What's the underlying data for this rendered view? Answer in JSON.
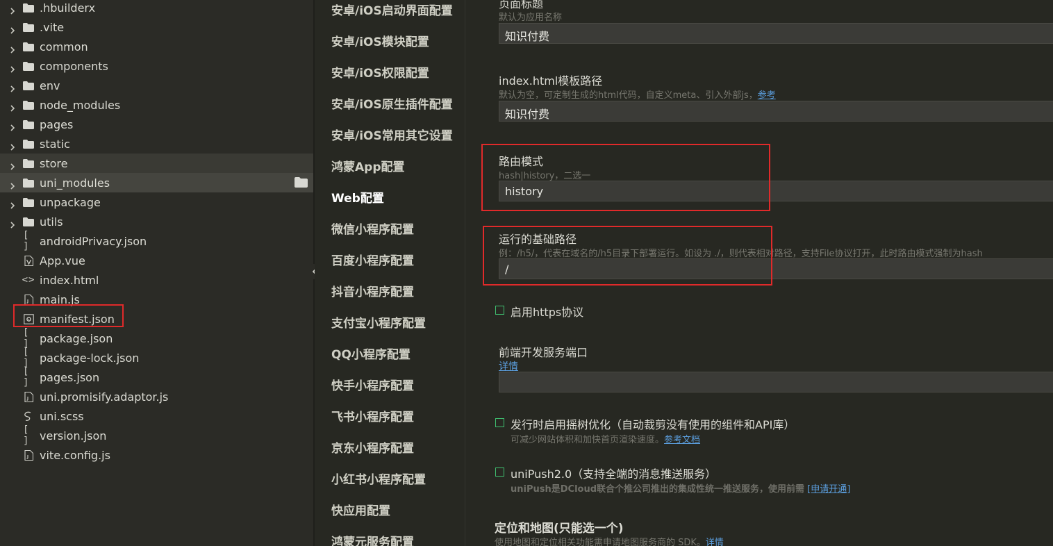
{
  "tree": {
    "items": [
      {
        "name": ".hbuilderx",
        "type": "folder"
      },
      {
        "name": ".vite",
        "type": "folder"
      },
      {
        "name": "common",
        "type": "folder"
      },
      {
        "name": "components",
        "type": "folder"
      },
      {
        "name": "env",
        "type": "folder"
      },
      {
        "name": "node_modules",
        "type": "folder"
      },
      {
        "name": "pages",
        "type": "folder"
      },
      {
        "name": "static",
        "type": "folder"
      },
      {
        "name": "store",
        "type": "folder",
        "state": "selected"
      },
      {
        "name": "uni_modules",
        "type": "folder",
        "state": "hover"
      },
      {
        "name": "unpackage",
        "type": "folder"
      },
      {
        "name": "utils",
        "type": "folder"
      },
      {
        "name": "androidPrivacy.json",
        "type": "json",
        "icon": "[ ]"
      },
      {
        "name": "App.vue",
        "type": "vue"
      },
      {
        "name": "index.html",
        "type": "html",
        "icon": "<>"
      },
      {
        "name": "main.js",
        "type": "js"
      },
      {
        "name": "manifest.json",
        "type": "manifest",
        "highlighted": true
      },
      {
        "name": "package.json",
        "type": "json",
        "icon": "[ ]"
      },
      {
        "name": "package-lock.json",
        "type": "json",
        "icon": "[ ]"
      },
      {
        "name": "pages.json",
        "type": "json",
        "icon": "[ ]"
      },
      {
        "name": "uni.promisify.adaptor.js",
        "type": "js"
      },
      {
        "name": "uni.scss",
        "type": "scss"
      },
      {
        "name": "version.json",
        "type": "json",
        "icon": "[ ]"
      },
      {
        "name": "vite.config.js",
        "type": "js"
      }
    ]
  },
  "nav": {
    "items": [
      {
        "label": "安卓/iOS启动界面配置"
      },
      {
        "label": "安卓/iOS模块配置"
      },
      {
        "label": "安卓/iOS权限配置"
      },
      {
        "label": "安卓/iOS原生插件配置"
      },
      {
        "label": "安卓/iOS常用其它设置"
      },
      {
        "label": "鸿蒙App配置"
      },
      {
        "label": "Web配置",
        "active": true
      },
      {
        "label": "微信小程序配置"
      },
      {
        "label": "百度小程序配置"
      },
      {
        "label": "抖音小程序配置"
      },
      {
        "label": "支付宝小程序配置"
      },
      {
        "label": "QQ小程序配置"
      },
      {
        "label": "快手小程序配置"
      },
      {
        "label": "飞书小程序配置"
      },
      {
        "label": "京东小程序配置"
      },
      {
        "label": "小红书小程序配置"
      },
      {
        "label": "快应用配置"
      },
      {
        "label": "鸿蒙元服务配置"
      }
    ]
  },
  "main": {
    "page_title": {
      "label": "页面标题",
      "hint": "默认为应用名称",
      "value": "知识付费"
    },
    "template": {
      "label": "index.html模板路径",
      "hint": "默认为空，可定制生成的html代码，自定义meta、引入外部js，",
      "hint_link": "参考",
      "value": "知识付费"
    },
    "router_mode": {
      "label": "路由模式",
      "hint": "hash|history，二选一",
      "value": "history"
    },
    "base_path": {
      "label": "运行的基础路径",
      "hint": "例：/h5/，代表在域名的/h5目录下部署运行。如设为 ./，则代表相对路径，支持File协议打开，此时路由模式强制为hash",
      "value": "/"
    },
    "https": {
      "label": "启用https协议"
    },
    "dev_port": {
      "label": "前端开发服务端口",
      "link": "详情",
      "value": ""
    },
    "tree_shaking": {
      "label": "发行时启用摇树优化（自动裁剪没有使用的组件和API库）",
      "hint": "可减少网站体积和加快首页渲染速度。",
      "hint_link": "参考文档"
    },
    "unipush": {
      "label": "uniPush2.0（支持全端的消息推送服务）",
      "hint": "uniPush是DCloud联合个推公司推出的集成性统一推送服务，使用前需",
      "hint_link": "[申请开通]"
    },
    "location": {
      "heading": "定位和地图(只能选一个)",
      "hint": "使用地图和定位相关功能需申请地图服务商的 SDK。",
      "hint_link": "详情"
    }
  },
  "colors": {
    "highlight_box": "#e02a2a",
    "checkbox": "#3fbf6f",
    "link": "#5b9ddc"
  }
}
